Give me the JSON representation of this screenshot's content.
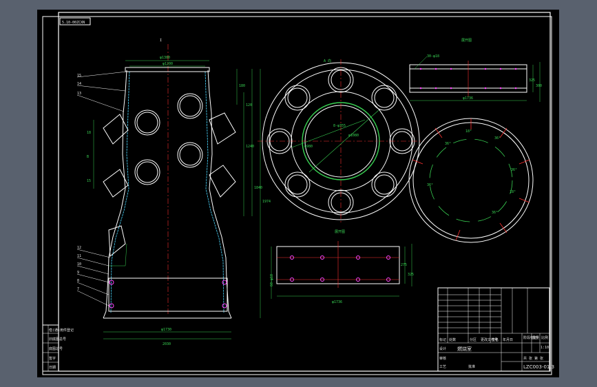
{
  "drawing": {
    "code_stamp": "5.10-00ZCXN",
    "main_view": {
      "marker": "I",
      "dims_top": [
        "φ1380",
        "φ1200"
      ],
      "dims_left": [
        "18",
        "B",
        "15"
      ],
      "dims_right": [
        "180",
        "120",
        "1240",
        "1840",
        "1974"
      ],
      "dims_bottom": [
        "φ1730",
        "2030"
      ],
      "callouts": [
        "15",
        "14",
        "13",
        "12",
        "11",
        "10",
        "9",
        "8",
        "7"
      ]
    },
    "top_view": {
      "title": "A 向",
      "dims": [
        "8-φ355",
        "φ1080",
        "φ980"
      ]
    },
    "detail_right_top": {
      "title": "展开图",
      "dims": [
        "30-φ18",
        "φ1736",
        "325",
        "300"
      ]
    },
    "detail_bottom": {
      "title": "展开图",
      "dims": [
        "φ1736",
        "275",
        "325",
        "60-φ18"
      ]
    },
    "ring_view": {
      "angles": [
        "36°",
        "18°",
        "36°",
        "36°",
        "18°",
        "36°",
        "36°"
      ]
    },
    "title_block": {
      "part_name": "燃烧室",
      "drawing_no": "LZC003-01.3",
      "labels": [
        "标记",
        "处数",
        "分区",
        "更改文件号",
        "签名",
        "年月日"
      ],
      "roles": [
        "设计",
        "审核",
        "工艺",
        "批准"
      ],
      "scale_hdr": [
        "阶段标记",
        "重量",
        "比例"
      ],
      "scale_val": "1:10",
      "sheet": "共 张 第 张"
    },
    "left_strip": [
      "借(通)用件登记",
      "旧底图总号",
      "底图总号",
      "签字",
      "日期"
    ]
  },
  "colors": {
    "outline": "#ffffff",
    "dimension": "#39d353",
    "center": "#ff3030",
    "cyan": "#4ad7ff",
    "hole": "#ff44ff"
  }
}
